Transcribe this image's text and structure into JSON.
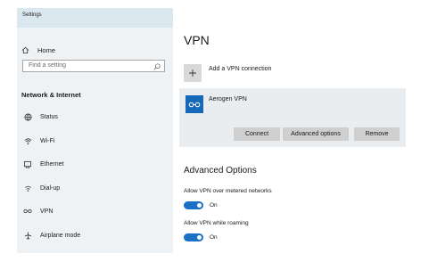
{
  "window": {
    "title": "Settings"
  },
  "sidebar": {
    "home_label": "Home",
    "search_placeholder": "Find a setting",
    "section_title": "Network & Internet",
    "items": [
      {
        "label": "Status",
        "icon": "globe-icon"
      },
      {
        "label": "Wi-Fi",
        "icon": "wifi-icon"
      },
      {
        "label": "Ethernet",
        "icon": "ethernet-icon"
      },
      {
        "label": "Dial-up",
        "icon": "dialup-icon"
      },
      {
        "label": "VPN",
        "icon": "vpn-icon"
      },
      {
        "label": "Airplane mode",
        "icon": "airplane-icon"
      }
    ]
  },
  "main": {
    "title": "VPN",
    "add_connection_label": "Add a VPN connection",
    "connection": {
      "name": "Aerogen VPN",
      "buttons": {
        "connect": "Connect",
        "advanced": "Advanced options",
        "remove": "Remove"
      }
    },
    "advanced": {
      "title": "Advanced Options",
      "metered": {
        "label": "Allow VPN over metered networks",
        "state": "On"
      },
      "roaming": {
        "label": "Allow VPN while roaming",
        "state": "On"
      }
    }
  },
  "colors": {
    "sidebar_bg": "#eef2f5",
    "header_bg": "#dbe7ee",
    "accent": "#1b6fc4",
    "vpn_logo": "#1668b8",
    "card_bg": "#eaedf0",
    "button_bg": "#cfcfcf"
  }
}
